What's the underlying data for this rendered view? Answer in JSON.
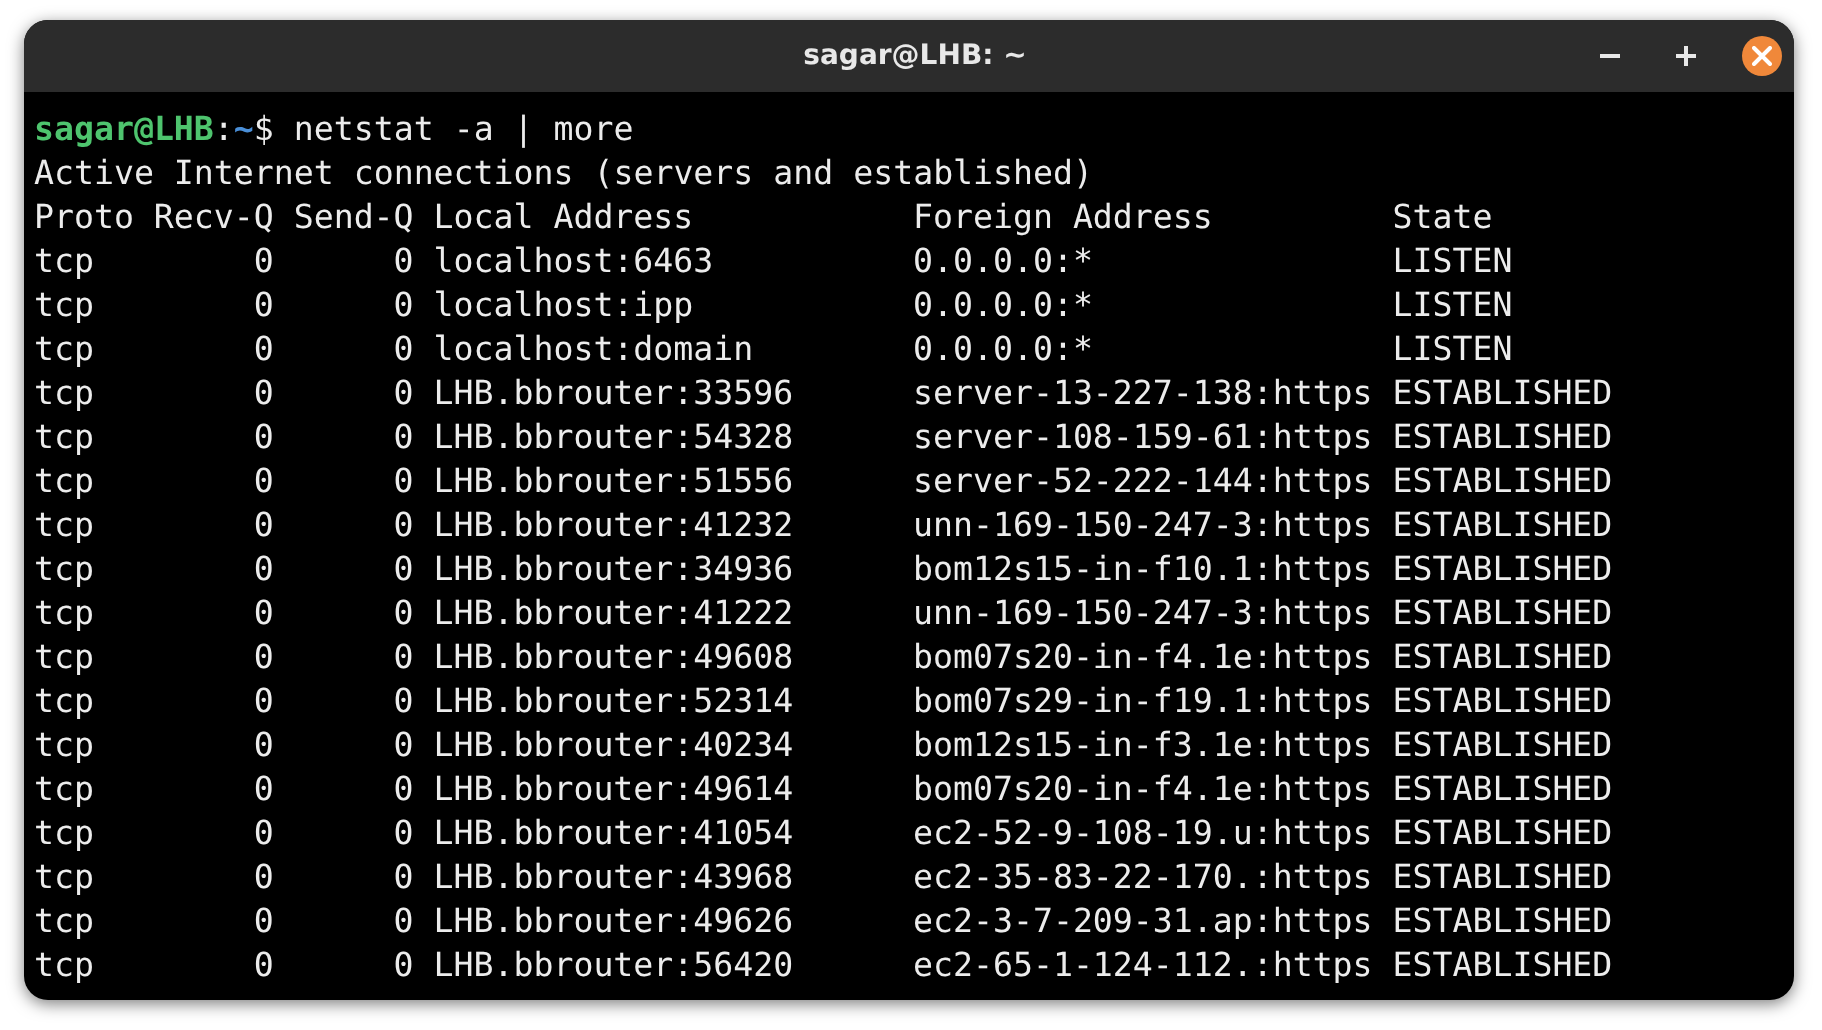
{
  "window": {
    "title": "sagar@LHB: ~"
  },
  "prompt": {
    "user_host": "sagar@LHB",
    "separator": ":",
    "path": "~",
    "symbol": "$",
    "command": "netstat -a | more"
  },
  "output_title": "Active Internet connections (servers and established)",
  "table": {
    "columns": [
      "Proto",
      "Recv-Q",
      "Send-Q",
      "Local Address",
      "Foreign Address",
      "State"
    ],
    "rows": [
      [
        "tcp",
        "0",
        "0",
        "localhost:6463",
        "0.0.0.0:*",
        "LISTEN"
      ],
      [
        "tcp",
        "0",
        "0",
        "localhost:ipp",
        "0.0.0.0:*",
        "LISTEN"
      ],
      [
        "tcp",
        "0",
        "0",
        "localhost:domain",
        "0.0.0.0:*",
        "LISTEN"
      ],
      [
        "tcp",
        "0",
        "0",
        "LHB.bbrouter:33596",
        "server-13-227-138:https",
        "ESTABLISHED"
      ],
      [
        "tcp",
        "0",
        "0",
        "LHB.bbrouter:54328",
        "server-108-159-61:https",
        "ESTABLISHED"
      ],
      [
        "tcp",
        "0",
        "0",
        "LHB.bbrouter:51556",
        "server-52-222-144:https",
        "ESTABLISHED"
      ],
      [
        "tcp",
        "0",
        "0",
        "LHB.bbrouter:41232",
        "unn-169-150-247-3:https",
        "ESTABLISHED"
      ],
      [
        "tcp",
        "0",
        "0",
        "LHB.bbrouter:34936",
        "bom12s15-in-f10.1:https",
        "ESTABLISHED"
      ],
      [
        "tcp",
        "0",
        "0",
        "LHB.bbrouter:41222",
        "unn-169-150-247-3:https",
        "ESTABLISHED"
      ],
      [
        "tcp",
        "0",
        "0",
        "LHB.bbrouter:49608",
        "bom07s20-in-f4.1e:https",
        "ESTABLISHED"
      ],
      [
        "tcp",
        "0",
        "0",
        "LHB.bbrouter:52314",
        "bom07s29-in-f19.1:https",
        "ESTABLISHED"
      ],
      [
        "tcp",
        "0",
        "0",
        "LHB.bbrouter:40234",
        "bom12s15-in-f3.1e:https",
        "ESTABLISHED"
      ],
      [
        "tcp",
        "0",
        "0",
        "LHB.bbrouter:49614",
        "bom07s20-in-f4.1e:https",
        "ESTABLISHED"
      ],
      [
        "tcp",
        "0",
        "0",
        "LHB.bbrouter:41054",
        "ec2-52-9-108-19.u:https",
        "ESTABLISHED"
      ],
      [
        "tcp",
        "0",
        "0",
        "LHB.bbrouter:43968",
        "ec2-35-83-22-170.:https",
        "ESTABLISHED"
      ],
      [
        "tcp",
        "0",
        "0",
        "LHB.bbrouter:49626",
        "ec2-3-7-209-31.ap:https",
        "ESTABLISHED"
      ],
      [
        "tcp",
        "0",
        "0",
        "LHB.bbrouter:56420",
        "ec2-65-1-124-112.:https",
        "ESTABLISHED"
      ]
    ]
  }
}
